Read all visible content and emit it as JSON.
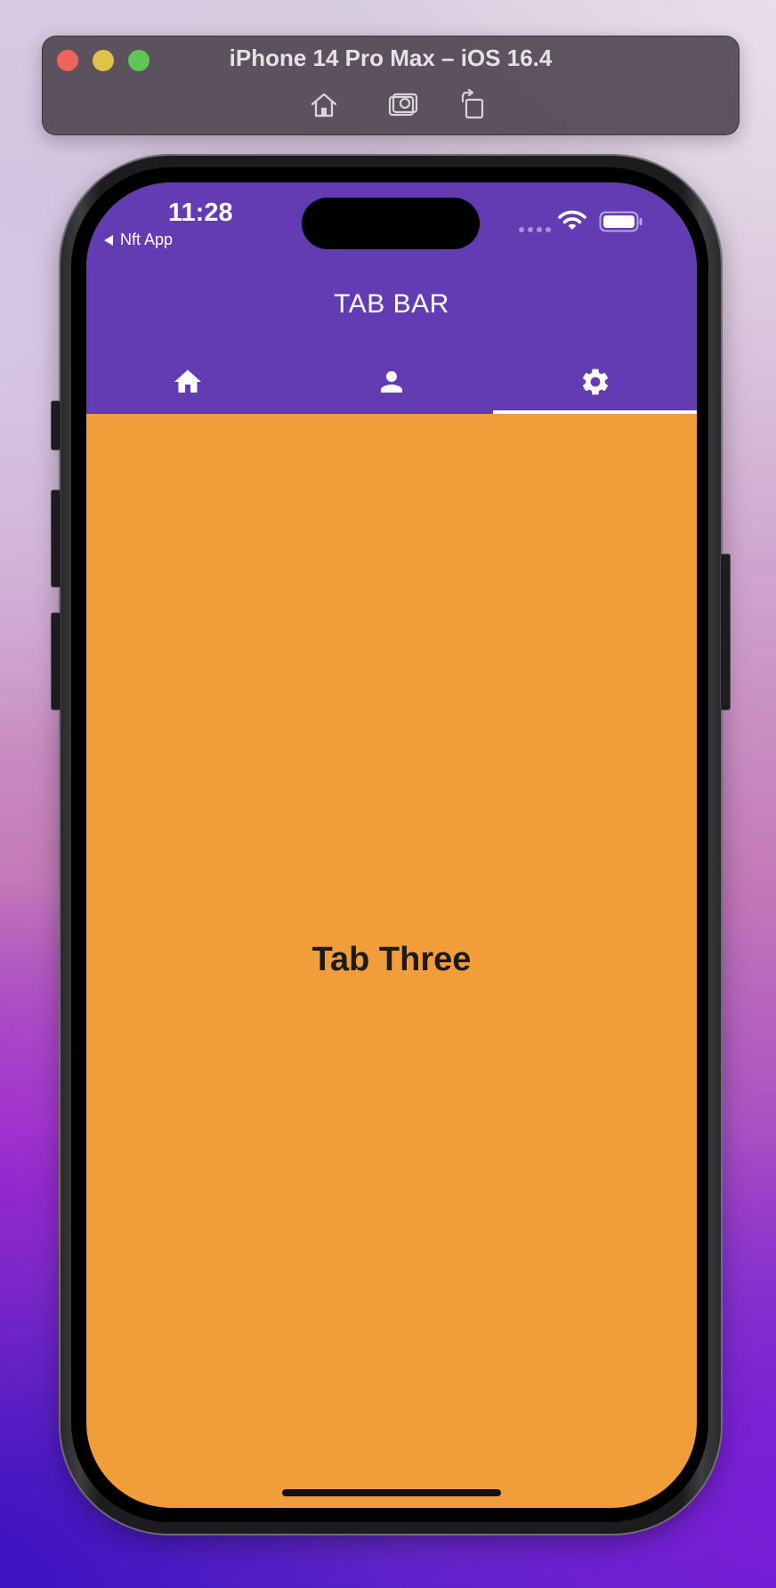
{
  "simulator": {
    "title": "iPhone 14 Pro Max – iOS 16.4",
    "toolbar_icons": [
      "home-icon",
      "screenshot-icon",
      "rotate-icon"
    ],
    "window_controls": [
      "close",
      "minimize",
      "zoom"
    ]
  },
  "status_bar": {
    "time": "11:28",
    "back_app_label": "Nft App",
    "icons": [
      "cellular-icon",
      "wifi-icon",
      "battery-icon"
    ]
  },
  "app_bar": {
    "title": "TAB BAR",
    "background_color": "#633cb3"
  },
  "tabs": [
    {
      "icon": "home-icon",
      "selected": false
    },
    {
      "icon": "person-icon",
      "selected": false
    },
    {
      "icon": "settings-gear-icon",
      "selected": true
    }
  ],
  "content": {
    "text": "Tab Three",
    "background_color": "#f09d3a"
  }
}
